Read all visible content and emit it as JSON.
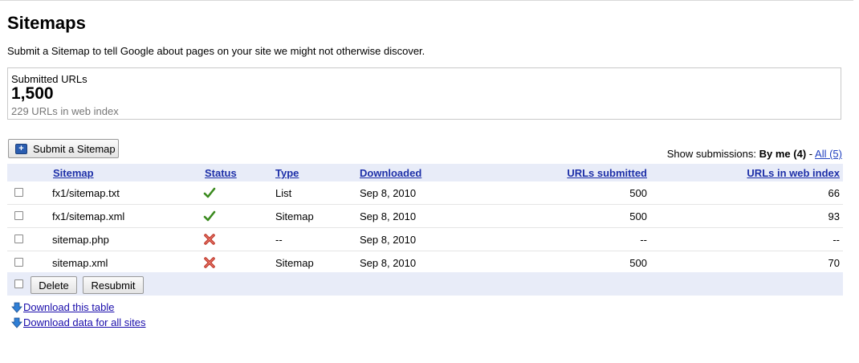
{
  "page": {
    "title": "Sitemaps",
    "subtitle": "Submit a Sitemap to tell Google about pages on your site we might not otherwise discover."
  },
  "summary": {
    "label": "Submitted URLs",
    "count": "1,500",
    "indexed": "229 URLs in web index"
  },
  "toolbar": {
    "submit_label": "Submit a Sitemap",
    "show_label": "Show submissions:",
    "by_me": "By me (4)",
    "separator": "-",
    "all": "All (5)"
  },
  "table": {
    "headers": {
      "sitemap": "Sitemap",
      "status": "Status",
      "type": "Type",
      "downloaded": "Downloaded",
      "urls_submitted": "URLs submitted",
      "urls_indexed": "URLs in web index"
    },
    "rows": [
      {
        "sitemap": "fx1/sitemap.txt",
        "status": "ok",
        "type": "List",
        "downloaded": "Sep 8, 2010",
        "submitted": "500",
        "indexed": "66"
      },
      {
        "sitemap": "fx1/sitemap.xml",
        "status": "ok",
        "type": "Sitemap",
        "downloaded": "Sep 8, 2010",
        "submitted": "500",
        "indexed": "93"
      },
      {
        "sitemap": "sitemap.php",
        "status": "error",
        "type": "--",
        "downloaded": "Sep 8, 2010",
        "submitted": "--",
        "indexed": "--"
      },
      {
        "sitemap": "sitemap.xml",
        "status": "error",
        "type": "Sitemap",
        "downloaded": "Sep 8, 2010",
        "submitted": "500",
        "indexed": "70"
      }
    ]
  },
  "actions": {
    "delete_label": "Delete",
    "resubmit_label": "Resubmit"
  },
  "downloads": {
    "table_label": "Download this table",
    "all_label": "Download data for all sites"
  },
  "icons": {
    "ok": "check-icon",
    "error": "x-icon",
    "download": "down-arrow-icon"
  },
  "colors": {
    "link": "#1a0dab",
    "header_bg": "#e8ecf8",
    "ok_green": "#3a8a1e",
    "error_red": "#c0392b"
  }
}
